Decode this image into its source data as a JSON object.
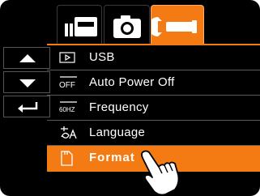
{
  "tabs": [
    {
      "id": "shortcut",
      "icon": "shortcut-icon",
      "active": false
    },
    {
      "id": "camera",
      "icon": "camera-icon",
      "active": false
    },
    {
      "id": "setup",
      "icon": "wrench-icon",
      "active": true
    }
  ],
  "nav": [
    {
      "icon": "arrow-up-icon"
    },
    {
      "icon": "arrow-down-icon"
    },
    {
      "icon": "return-icon"
    }
  ],
  "menu": {
    "items": [
      {
        "label": "USB",
        "icon": "usb-connection-icon",
        "selected": false
      },
      {
        "label": "Auto Power Off",
        "icon": "auto-power-off-icon",
        "icon_text": "OFF",
        "selected": false
      },
      {
        "label": "Frequency",
        "icon": "frequency-icon",
        "icon_text": "60HZ",
        "selected": false
      },
      {
        "label": "Language",
        "icon": "language-icon",
        "selected": false
      },
      {
        "label": "Format",
        "icon": "format-memory-icon",
        "selected": true
      }
    ]
  },
  "colors": {
    "accent": "#f47a14",
    "background": "#000000",
    "text": "#ffffff"
  }
}
